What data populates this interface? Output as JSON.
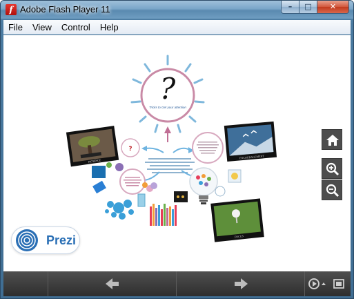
{
  "window": {
    "title": "Adobe Flash Player 11",
    "app_icon_glyph": "f",
    "minimize_glyph": "–",
    "maximize_glyph": "□",
    "close_glyph": "✕"
  },
  "menu": {
    "items": [
      "File",
      "View",
      "Control",
      "Help"
    ]
  },
  "prezi": {
    "logo_text": "Prezi",
    "center_caption": "Tricks to Get your attention",
    "center_glyph": "?"
  },
  "pictures": {
    "bonsai_caption": "PATIENCE",
    "birds_caption": "ENCOURAGEMENT",
    "golf_caption": "FOCUS"
  },
  "nav": {
    "home_icon": "home-icon",
    "zoom_in_icon": "zoom-in-icon",
    "zoom_out_icon": "zoom-out-icon"
  },
  "bottom": {
    "prev_icon": "arrow-left-icon",
    "next_icon": "arrow-right-icon",
    "autoplay_icon": "autoplay-icon",
    "fullscreen_icon": "fullscreen-icon"
  },
  "colors": {
    "circle_pink": "#c98aa6",
    "sun_ray_blue": "#7fb8dc",
    "arrow_blue": "#6fb4e0",
    "control_gray": "#4d4d4d"
  }
}
